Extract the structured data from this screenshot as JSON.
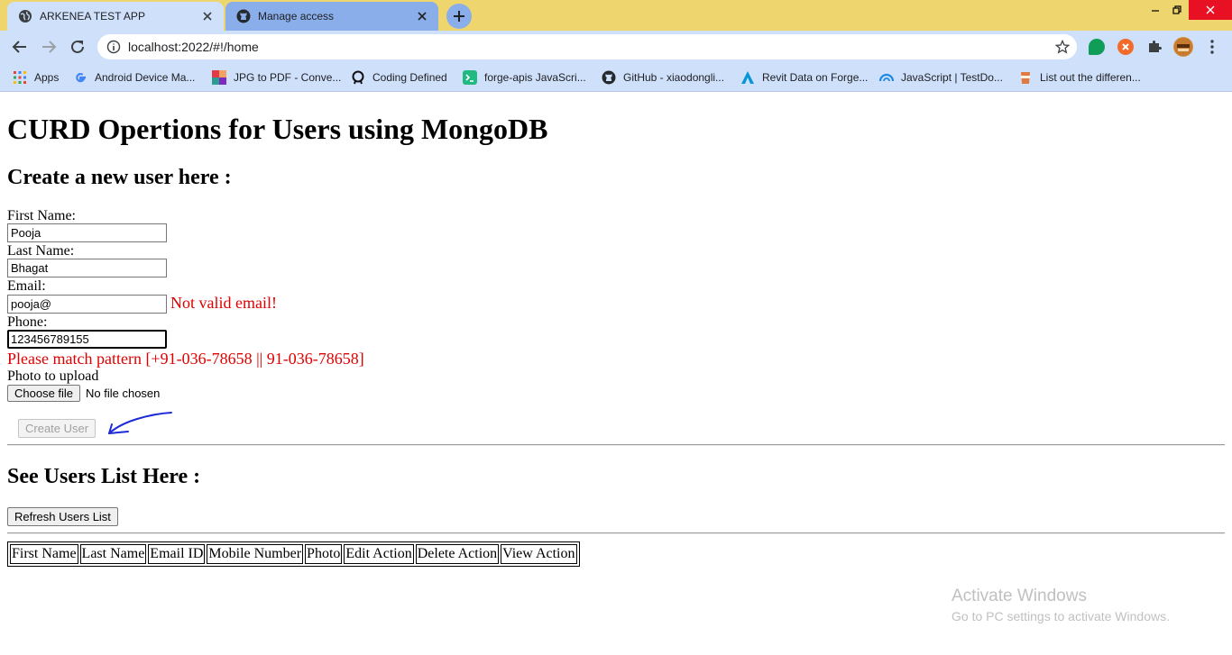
{
  "browser": {
    "tabs": [
      {
        "title": "ARKENEA TEST APP",
        "icon": "globe-icon",
        "active": true
      },
      {
        "title": "Manage access",
        "icon": "github-icon",
        "active": false
      }
    ],
    "url": "localhost:2022/#!/home",
    "bookmarks": [
      {
        "label": "Apps",
        "icon": "apps-grid-icon"
      },
      {
        "label": "Android Device Ma...",
        "icon": "google-icon"
      },
      {
        "label": "JPG to PDF - Conve...",
        "icon": "jpg-to-pdf-icon"
      },
      {
        "label": "Coding Defined",
        "icon": "coding-defined-icon"
      },
      {
        "label": "forge-apis JavaScri...",
        "icon": "terminal-icon"
      },
      {
        "label": "GitHub - xiaodongli...",
        "icon": "github-icon"
      },
      {
        "label": "Revit Data on Forge...",
        "icon": "autodesk-icon"
      },
      {
        "label": "JavaScript | TestDo...",
        "icon": "testdome-icon"
      },
      {
        "label": "List out the differen...",
        "icon": "cup-icon"
      }
    ]
  },
  "page": {
    "title": "CURD Opertions for Users using MongoDB",
    "create_heading": "Create a new user here :",
    "form": {
      "first_name_label": "First Name:",
      "first_name_value": "Pooja",
      "last_name_label": "Last Name:",
      "last_name_value": "Bhagat",
      "email_label": "Email:",
      "email_value": "pooja@",
      "email_error": "Not valid email!",
      "phone_label": "Phone:",
      "phone_value": "123456789155",
      "phone_error": "Please match pattern [+91-036-78658 || 91-036-78658]",
      "photo_label": "Photo to upload",
      "choose_file_label": "Choose file",
      "file_status": "No file chosen",
      "create_button": "Create User"
    },
    "users_heading": "See Users List Here :",
    "refresh_button": "Refresh Users List",
    "table_headers": [
      "First Name",
      "Last Name",
      "Email ID",
      "Mobile Number",
      "Photo",
      "Edit Action",
      "Delete Action",
      "View Action"
    ]
  },
  "watermark": {
    "line1": "Activate Windows",
    "line2": "Go to PC settings to activate Windows."
  }
}
